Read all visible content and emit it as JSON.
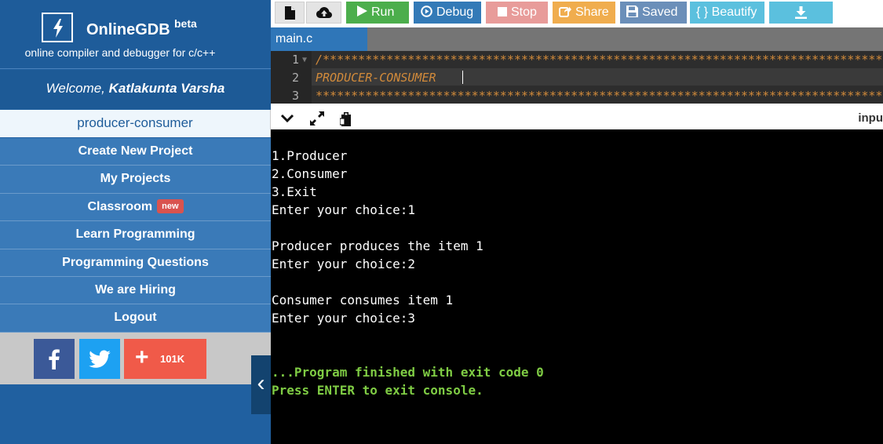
{
  "brand": {
    "name": "OnlineGDB",
    "beta": "beta",
    "tagline": "online compiler and debugger for c/c++",
    "logo_icon": "lightning-bolt-icon"
  },
  "welcome": {
    "prefix": "Welcome, ",
    "user": "Katlakunta Varsha"
  },
  "project_name": "producer-consumer",
  "menu": {
    "create": "Create New Project",
    "my_projects": "My Projects",
    "classroom": "Classroom",
    "classroom_badge": "new",
    "learn": "Learn Programming",
    "questions": "Programming Questions",
    "hiring": "We are Hiring",
    "logout": "Logout"
  },
  "social": {
    "share_count": "101K",
    "plus": "+"
  },
  "toolbar": {
    "run": "Run",
    "debug": "Debug",
    "stop": "Stop",
    "share": "Share",
    "saved": "Saved",
    "beautify": "{ } Beautify"
  },
  "tabs": {
    "main": "main.c"
  },
  "editor": {
    "lines": [
      {
        "num": "1",
        "text": "/*************************************************************************************"
      },
      {
        "num": "2",
        "text": "PRODUCER-CONSUMER"
      },
      {
        "num": "3",
        "text": "**************************************************************************************"
      }
    ]
  },
  "console_bar": {
    "input_label": "inpu"
  },
  "console": {
    "lines": [
      "1.Producer",
      "2.Consumer",
      "3.Exit",
      "Enter your choice:1",
      "Producer produces the item 1",
      "Enter your choice:2",
      "Consumer consumes item 1",
      "Enter your choice:3"
    ],
    "finished": "...Program finished with exit code 0",
    "press_enter": "Press ENTER to exit console."
  },
  "colors": {
    "sidebar": "#2060a0",
    "menu_item": "#3a7ab8",
    "run": "#4cae4c",
    "debug": "#337ab7",
    "stop": "#e89c9a",
    "share": "#f0ad4e",
    "beautify": "#5bc0de",
    "console_success": "#7fcc44"
  }
}
